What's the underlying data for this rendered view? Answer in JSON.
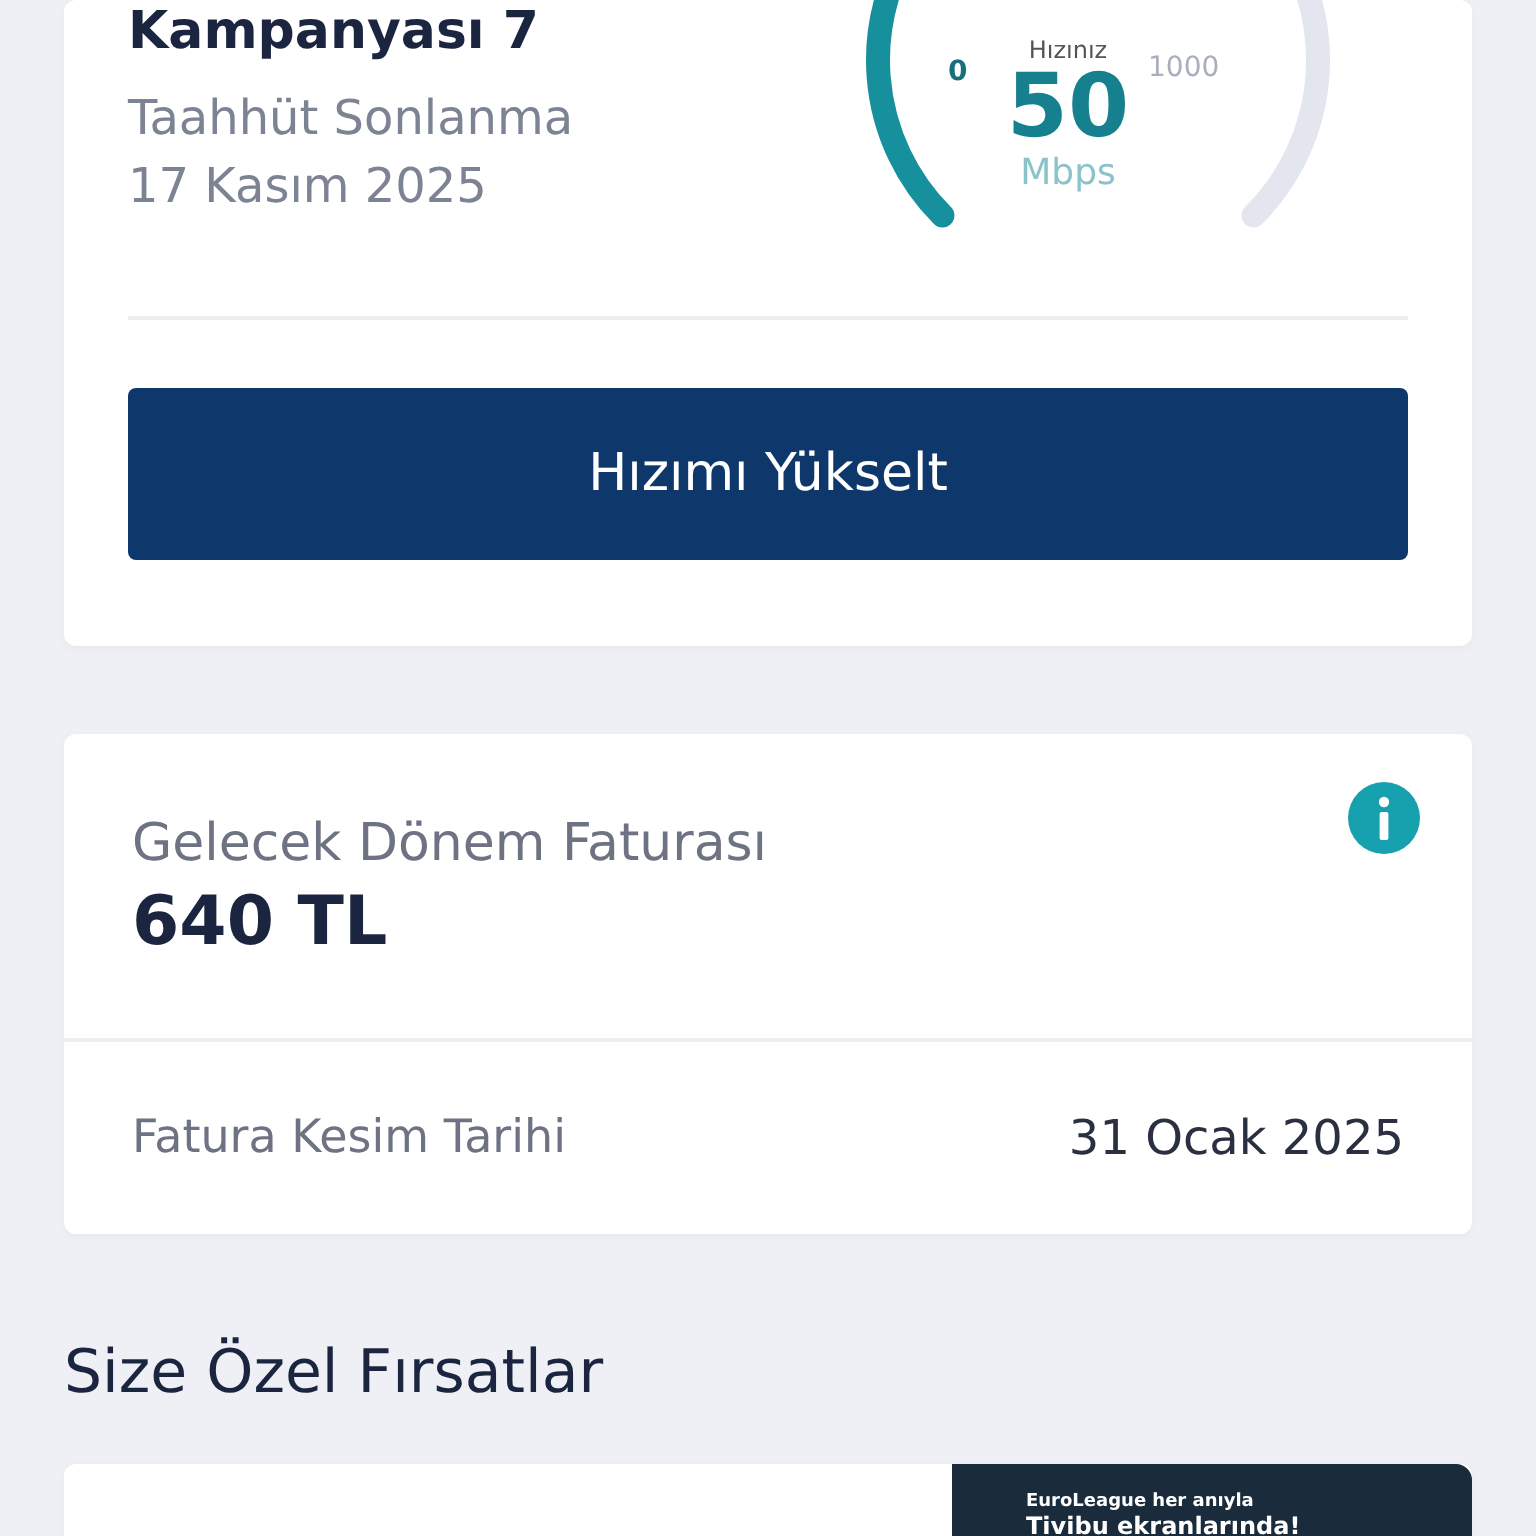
{
  "plan_card": {
    "title": "Kampanyası 7",
    "commitment_label": "Taahhüt Sonlanma",
    "commitment_date": "17 Kasım 2025",
    "gauge": {
      "label": "Hızınız",
      "value": "50",
      "unit": "Mbps",
      "min_label": "0",
      "max_label": "1000"
    },
    "button": "Hızımı Yükselt"
  },
  "bill_card": {
    "title": "Gelecek Dönem Faturası",
    "amount": "640 TL",
    "cut_label": "Fatura Kesim Tarihi",
    "cut_date": "31 Ocak 2025"
  },
  "offers": {
    "heading": "Size Özel Fırsatlar",
    "banner": {
      "line_1": "EuroLeague her anıyla",
      "line_2": "Tivibu ekranlarında!"
    }
  }
}
